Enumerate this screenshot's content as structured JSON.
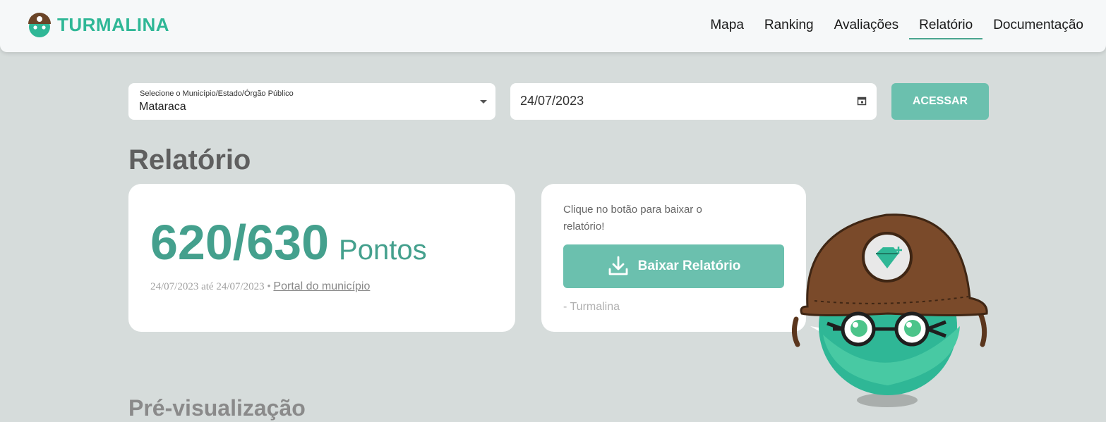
{
  "brand": {
    "name": "TURMALINA",
    "color": "#2fb796"
  },
  "nav": {
    "items": [
      {
        "label": "Mapa"
      },
      {
        "label": "Ranking"
      },
      {
        "label": "Avaliações"
      },
      {
        "label": "Relatório",
        "active": true
      },
      {
        "label": "Documentação"
      }
    ]
  },
  "filters": {
    "select_label": "Selecione o Município/Estado/Órgão Público",
    "select_value": "Mataraca",
    "date_value": "24/07/2023",
    "access_label": "ACESSAR"
  },
  "report": {
    "title": "Relatório",
    "score": "620/630",
    "unit": "Pontos",
    "period": "24/07/2023 até 24/07/2023",
    "separator": "•",
    "portal_link": "Portal do município"
  },
  "download": {
    "text": "Clique no botão para baixar o relatório!",
    "button_label": "Baixar Relatório",
    "signature": "- Turmalina"
  },
  "preview": {
    "title": "Pré-visualização"
  },
  "colors": {
    "accent": "#6bc0ae",
    "score": "#44a08d",
    "background": "#d6dcdb",
    "helmet": "#7a4a2a"
  }
}
